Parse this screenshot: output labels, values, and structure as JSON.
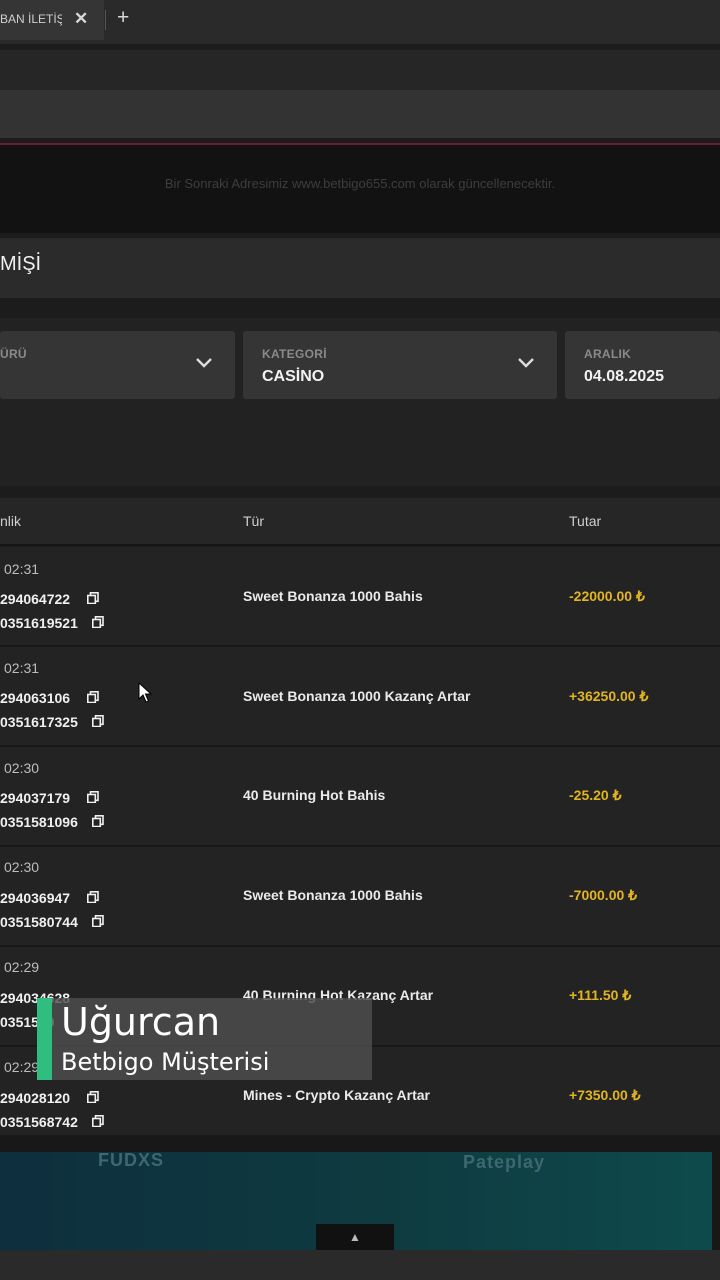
{
  "browser": {
    "tab_label": "BAN İLETİŞ",
    "tab_close": "✕",
    "new_tab": "+"
  },
  "banner": {
    "text": "Bir Sonraki Adresimiz www.betbigo655.com olarak güncellenecektir."
  },
  "page": {
    "title": "MİŞİ"
  },
  "filters": {
    "type": {
      "label": "ÜRÜ",
      "value": ""
    },
    "category": {
      "label": "KATEGORİ",
      "value": "CASİNO"
    },
    "range": {
      "label": "ARALIK",
      "value": "04.08.2025"
    }
  },
  "table": {
    "headers": {
      "date": "nlik",
      "type": "Tür",
      "amount": "Tutar"
    },
    "rows": [
      {
        "time": "02:31",
        "id1": "294064722",
        "id2": "0351619521",
        "type": "Sweet Bonanza 1000 Bahis",
        "amount": "-22000.00 ₺"
      },
      {
        "time": "02:31",
        "id1": "294063106",
        "id2": "0351617325",
        "type": "Sweet Bonanza 1000 Kazanç Artar",
        "amount": "+36250.00 ₺"
      },
      {
        "time": "02:30",
        "id1": "294037179",
        "id2": "0351581096",
        "type": "40 Burning Hot Bahis",
        "amount": "-25.20 ₺"
      },
      {
        "time": "02:30",
        "id1": "294036947",
        "id2": "0351580744",
        "type": "Sweet Bonanza 1000 Bahis",
        "amount": "-7000.00 ₺"
      },
      {
        "time": "02:29",
        "id1": "294034628",
        "id2": "0351579",
        "type": "40 Burning Hot Kazanç Artar",
        "amount": "+111.50 ₺"
      },
      {
        "time": "02:29",
        "id1": "294028120",
        "id2": "0351568742",
        "type": "Mines - Crypto Kazanç Artar",
        "amount": "+7350.00 ₺"
      }
    ]
  },
  "footer": {
    "logo_left": "FUDXS",
    "logo_right": "Pateplay",
    "scroll_top": "▲"
  },
  "overlay": {
    "name": "Uğurcan",
    "subtitle": "Betbigo Müşterisi"
  },
  "colors": {
    "amount": "#e2b423",
    "overlay_accent": "#2fbe7f"
  }
}
